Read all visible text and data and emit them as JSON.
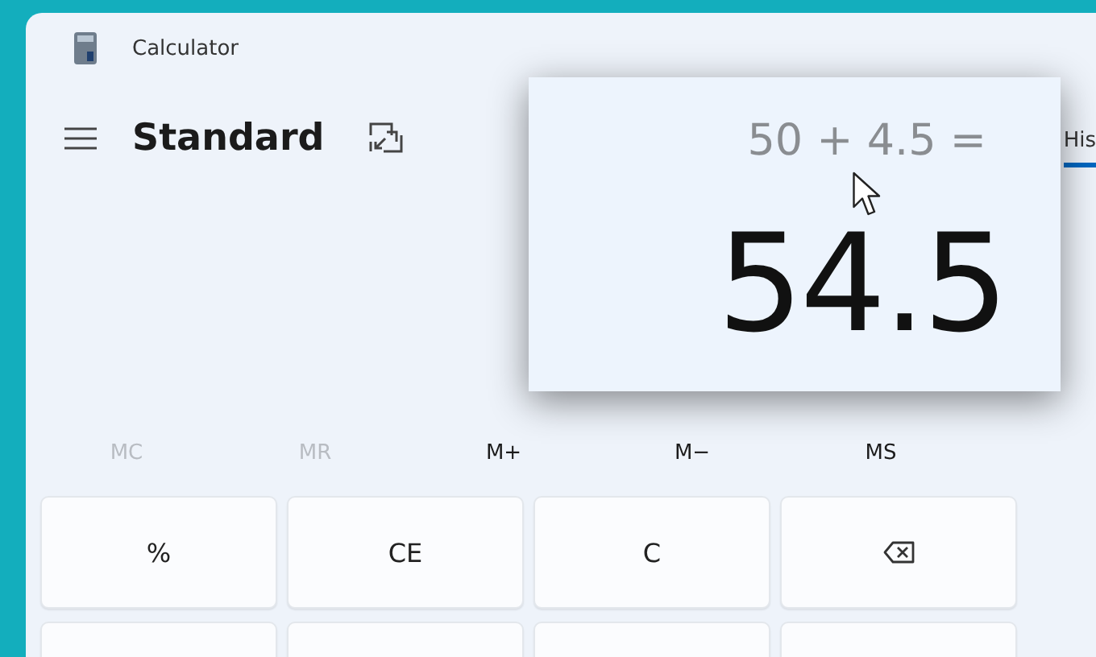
{
  "window": {
    "title": "Calculator"
  },
  "header": {
    "mode": "Standard"
  },
  "side_tabs": [
    {
      "label": "His",
      "selected": true
    }
  ],
  "display": {
    "expression": "50 + 4.5 =",
    "result": "54.5"
  },
  "memory": [
    {
      "label": "MC",
      "disabled": true
    },
    {
      "label": "MR",
      "disabled": true
    },
    {
      "label": "M+",
      "disabled": false
    },
    {
      "label": "M−",
      "disabled": false
    },
    {
      "label": "MS",
      "disabled": false
    }
  ],
  "keys": [
    {
      "kind": "text",
      "label": "%"
    },
    {
      "kind": "text",
      "label": "CE"
    },
    {
      "kind": "text",
      "label": "C"
    },
    {
      "kind": "backspace"
    },
    {
      "kind": "blank"
    },
    {
      "kind": "blank"
    },
    {
      "kind": "blank"
    },
    {
      "kind": "blank"
    }
  ]
}
